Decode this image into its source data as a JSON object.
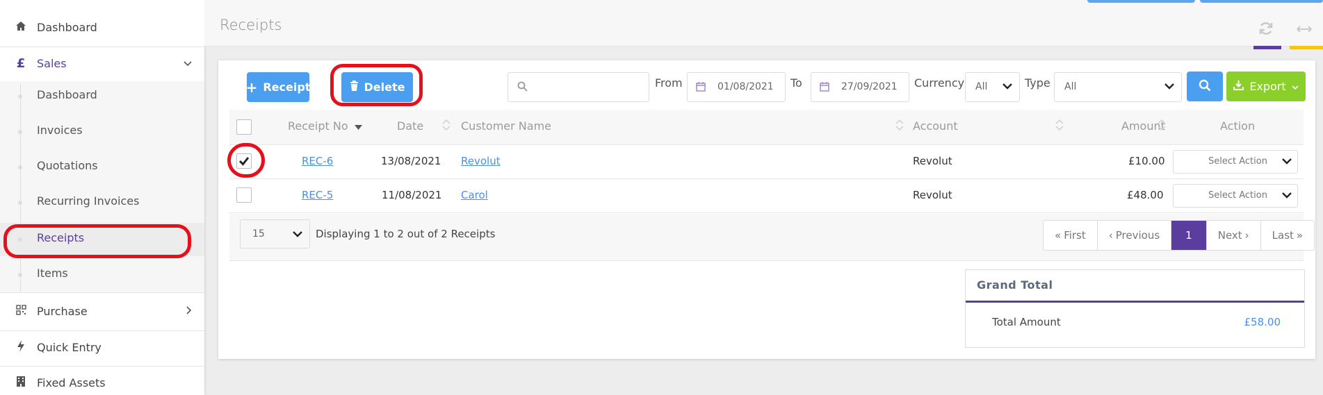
{
  "sidebar": {
    "dashboard": "Dashboard",
    "sales": "Sales",
    "sales_icon": "£",
    "sub_items": [
      "Dashboard",
      "Invoices",
      "Quotations",
      "Recurring Invoices",
      "Receipts",
      "Items"
    ],
    "purchase": "Purchase",
    "quick_entry": "Quick Entry",
    "fixed_assets": "Fixed Assets"
  },
  "header": {
    "title": "Receipts"
  },
  "toolbar": {
    "receipt_label": "Receipt",
    "delete_label": "Delete",
    "search_placeholder": "",
    "from_label": "From",
    "from_date": "01/08/2021",
    "to_label": "To",
    "to_date": "27/09/2021",
    "currency_label": "Currency",
    "currency_value": "All",
    "type_label": "Type",
    "type_value": "All",
    "export_label": "Export"
  },
  "table": {
    "columns": [
      "Receipt No",
      "Date",
      "Customer Name",
      "Account",
      "Amount",
      "Action"
    ],
    "rows": [
      {
        "receipt_no": "REC-6",
        "date": "13/08/2021",
        "customer": "Revolut",
        "account": "Revolut",
        "amount": "£10.00",
        "action": "Select Action",
        "checked": true
      },
      {
        "receipt_no": "REC-5",
        "date": "11/08/2021",
        "customer": "Carol",
        "account": "Revolut",
        "amount": "£48.00",
        "action": "Select Action",
        "checked": false
      }
    ]
  },
  "footer": {
    "page_size": "15",
    "display_text": "Displaying 1 to 2 out of 2 Receipts",
    "first": "First",
    "previous": "Previous",
    "current_page": "1",
    "next": "Next",
    "last": "Last"
  },
  "totals": {
    "title": "Grand Total",
    "label": "Total Amount",
    "value": "£58.00"
  },
  "colors": {
    "accent_purple": "#5b3da0",
    "primary_blue": "#4a9ff0",
    "export_green": "#8bcf2b",
    "highlight_red": "#e4101b"
  }
}
